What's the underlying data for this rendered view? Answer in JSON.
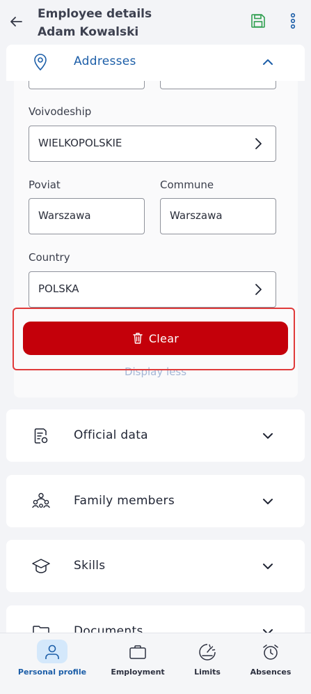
{
  "header": {
    "title_line1": "Employee details",
    "title_line2": "Adam Kowalski"
  },
  "addresses": {
    "title": "Addresses",
    "fields": {
      "voivodeship": {
        "label": "Voivodeship",
        "value": "WIELKOPOLSKIE"
      },
      "poviat": {
        "label": "Poviat",
        "value": "Warszawa"
      },
      "commune": {
        "label": "Commune",
        "value": "Warszawa"
      },
      "country": {
        "label": "Country",
        "value": "POLSKA"
      }
    },
    "clear_label": "Clear",
    "display_less": "Display less"
  },
  "sections": [
    {
      "title": "Official data",
      "icon": "official-data-icon"
    },
    {
      "title": "Family members",
      "icon": "family-members-icon"
    },
    {
      "title": "Skills",
      "icon": "skills-icon"
    },
    {
      "title": "Documents",
      "icon": "documents-icon"
    }
  ],
  "bottom_nav": [
    {
      "label": "Personal profile",
      "icon": "person-icon",
      "active": true
    },
    {
      "label": "Employment",
      "icon": "briefcase-icon",
      "active": false
    },
    {
      "label": "Limits",
      "icon": "limits-gauge-icon",
      "active": false
    },
    {
      "label": "Absences",
      "icon": "alarm-clock-icon",
      "active": false
    }
  ],
  "colors": {
    "accent": "#1c5ea8",
    "danger": "#c4000a",
    "save_icon": "#2e9e4f"
  }
}
